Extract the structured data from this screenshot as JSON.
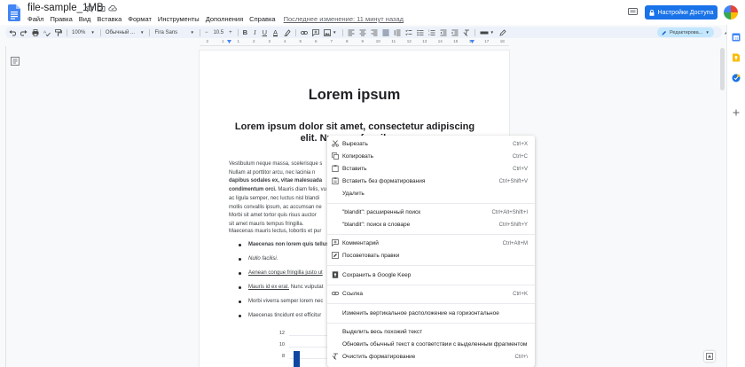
{
  "app": {
    "doc_title": "file-sample_1MB",
    "menus": [
      "Файл",
      "Правка",
      "Вид",
      "Вставка",
      "Формат",
      "Инструменты",
      "Дополнения",
      "Справка"
    ],
    "last_edit": "Последнее изменение: 11 минут назад",
    "share_label": "Настройки Доступа",
    "brand_color": "#1a73e8"
  },
  "toolbar": {
    "zoom": "100%",
    "style": "Обычный ...",
    "font": "Fira Sans",
    "font_size": "10.5",
    "bold": "B",
    "italic": "I",
    "underline": "U",
    "text_color": "A",
    "edit_mode": "Редактирова..."
  },
  "ruler": {
    "numbers": [
      "2",
      "1",
      "1",
      "2",
      "3",
      "4",
      "5",
      "6",
      "7",
      "8",
      "9",
      "10",
      "11",
      "12",
      "13",
      "14",
      "15",
      "16",
      "17",
      "18"
    ]
  },
  "document": {
    "heading": "Lorem ipsum",
    "subheading": "Lorem ipsum dolor sit amet, consectetur adipiscing elit. Nunc ac faucibus o",
    "para1_lines": [
      {
        "text": "Vestibulum neque massa, scelerisque s",
        "bold": false
      },
      {
        "text": "Nullam at porttitor arcu, nec lacinia n",
        "bold": false
      },
      {
        "text": "dapibus sodales ex, vitae malesuada",
        "bold": true
      },
      {
        "text": "condimentum orci.",
        "bold": true,
        "rest": " Mauris diam felis, vu"
      },
      {
        "text": "ac ligula semper, nec luctus nisl blandi",
        "bold": false
      },
      {
        "text": "mollis convallis ipsum, ac accumsan ne",
        "bold": false
      },
      {
        "text": "Morbi sit amet tortor quis risus auctor",
        "bold": false
      },
      {
        "text": "sit amet mauris tempus fringilla.",
        "bold": false
      }
    ],
    "para2": "Maecenas mauris lectus, lobortis et pur",
    "bullets": [
      {
        "text": "Maecenas non lorem quis tellus",
        "style": "bold"
      },
      {
        "text": "Nullo facilisi.",
        "style": "italic"
      },
      {
        "text": "Aenean congue fringilla justo ut",
        "style": "underline"
      },
      {
        "text": "Mauris id ex erat.",
        "style": "underline",
        "rest": " Nunc vulputat"
      },
      {
        "text": "Morbi viverra semper lorem nec",
        "style": "normal"
      },
      {
        "text": "Maecenas tincidunt est efficitur",
        "style": "normal"
      }
    ],
    "chart_axis": [
      "12",
      "10",
      "8"
    ]
  },
  "context_menu": {
    "items": [
      {
        "icon": "scissors-icon",
        "label": "Вырезать",
        "shortcut": "Ctrl+X"
      },
      {
        "icon": "copy-icon",
        "label": "Копировать",
        "shortcut": "Ctrl+C"
      },
      {
        "icon": "paste-icon",
        "label": "Вставить",
        "shortcut": "Ctrl+V"
      },
      {
        "icon": "paste-plain-icon",
        "label": "Вставить без форматирования",
        "shortcut": "Ctrl+Shift+V"
      },
      {
        "icon": "",
        "label": "Удалить",
        "shortcut": ""
      },
      {
        "icon": "",
        "label": "\"blandit\": расширенный поиск",
        "shortcut": "Ctrl+Alt+Shift+I"
      },
      {
        "icon": "",
        "label": "\"blandit\": поиск в словаре",
        "shortcut": "Ctrl+Shift+Y"
      },
      {
        "icon": "comment-add-icon",
        "label": "Комментарий",
        "shortcut": "Ctrl+Alt+M"
      },
      {
        "icon": "suggest-edits-icon",
        "label": "Посоветовать правки",
        "shortcut": ""
      },
      {
        "icon": "keep-icon",
        "label": "Сохранить в Google Keep",
        "shortcut": ""
      },
      {
        "icon": "link-icon",
        "label": "Ссылка",
        "shortcut": "Ctrl+K"
      },
      {
        "icon": "",
        "label": "Изменить вертикальное расположение на горизонтальное",
        "shortcut": ""
      },
      {
        "icon": "",
        "label": "Выделить весь похожий текст",
        "shortcut": ""
      },
      {
        "icon": "",
        "label": "Обновить обычный текст в соответствии с выделенным фрагментом",
        "shortcut": ""
      },
      {
        "icon": "clear-format-icon",
        "label": "Очистить форматирование",
        "shortcut": "Ctrl+\\"
      }
    ]
  }
}
